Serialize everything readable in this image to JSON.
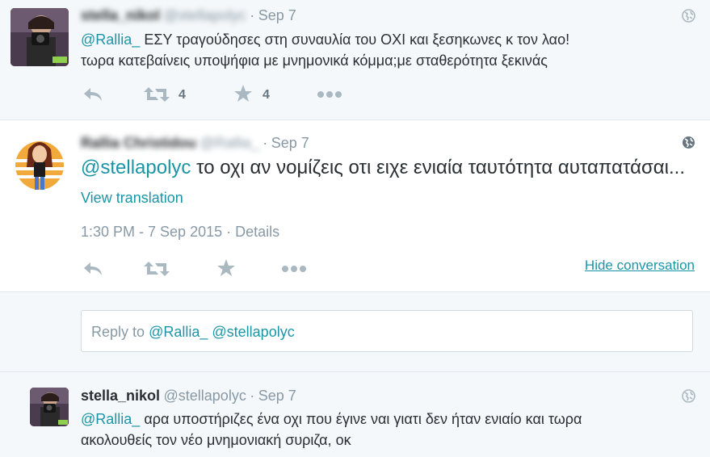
{
  "tweet1": {
    "display_name": "stella_nikol",
    "handle": "@stellapolyc",
    "separator": "·",
    "date": "Sep 7",
    "mention": "@Rallia_",
    "text_line1": "ΕΣΥ τραγούδησες στη συναυλία του ΟΧΙ  και ξεσηκωνες κ τον λαο!",
    "text_line2": "τωρα κατεβαίνεις υποψήφια με μνημονικά κόμμα;με σταθερότητα ξεκινάς",
    "retweet_count": "4",
    "like_count": "4"
  },
  "tweet2": {
    "display_name": "Rallia Christidou",
    "handle": "@Rallia_",
    "separator": "·",
    "date": "Sep 7",
    "mention": "@stellapolyc",
    "text": "το οχι αν νομίζεις οτι ειχε ενιαία ταυτότητα αυταπατάσαι...",
    "view_translation": "View translation",
    "timestamp": "1:30 PM - 7 Sep 2015",
    "details_separator": "·",
    "details": "Details",
    "hide_conversation": "Hide conversation"
  },
  "reply_box": {
    "prefix": "Reply to",
    "mention1": "@Rallia_",
    "mention2": "@stellapolyc"
  },
  "tweet3": {
    "display_name": "stella_nikol",
    "handle": "@stellapolyc",
    "separator": "·",
    "date": "Sep 7",
    "mention": "@Rallia_",
    "text_line1": "αρα υποστήριζες ένα οχι που έγινε ναι γιατι δεν ήταν ενιαίο και τωρα",
    "text_line2": "ακολουθείς τον νέο μνημονιακή συριζα, οκ"
  },
  "colors": {
    "accent": "#1b95a6",
    "muted": "#8899a6",
    "icon": "#aab8c2"
  }
}
